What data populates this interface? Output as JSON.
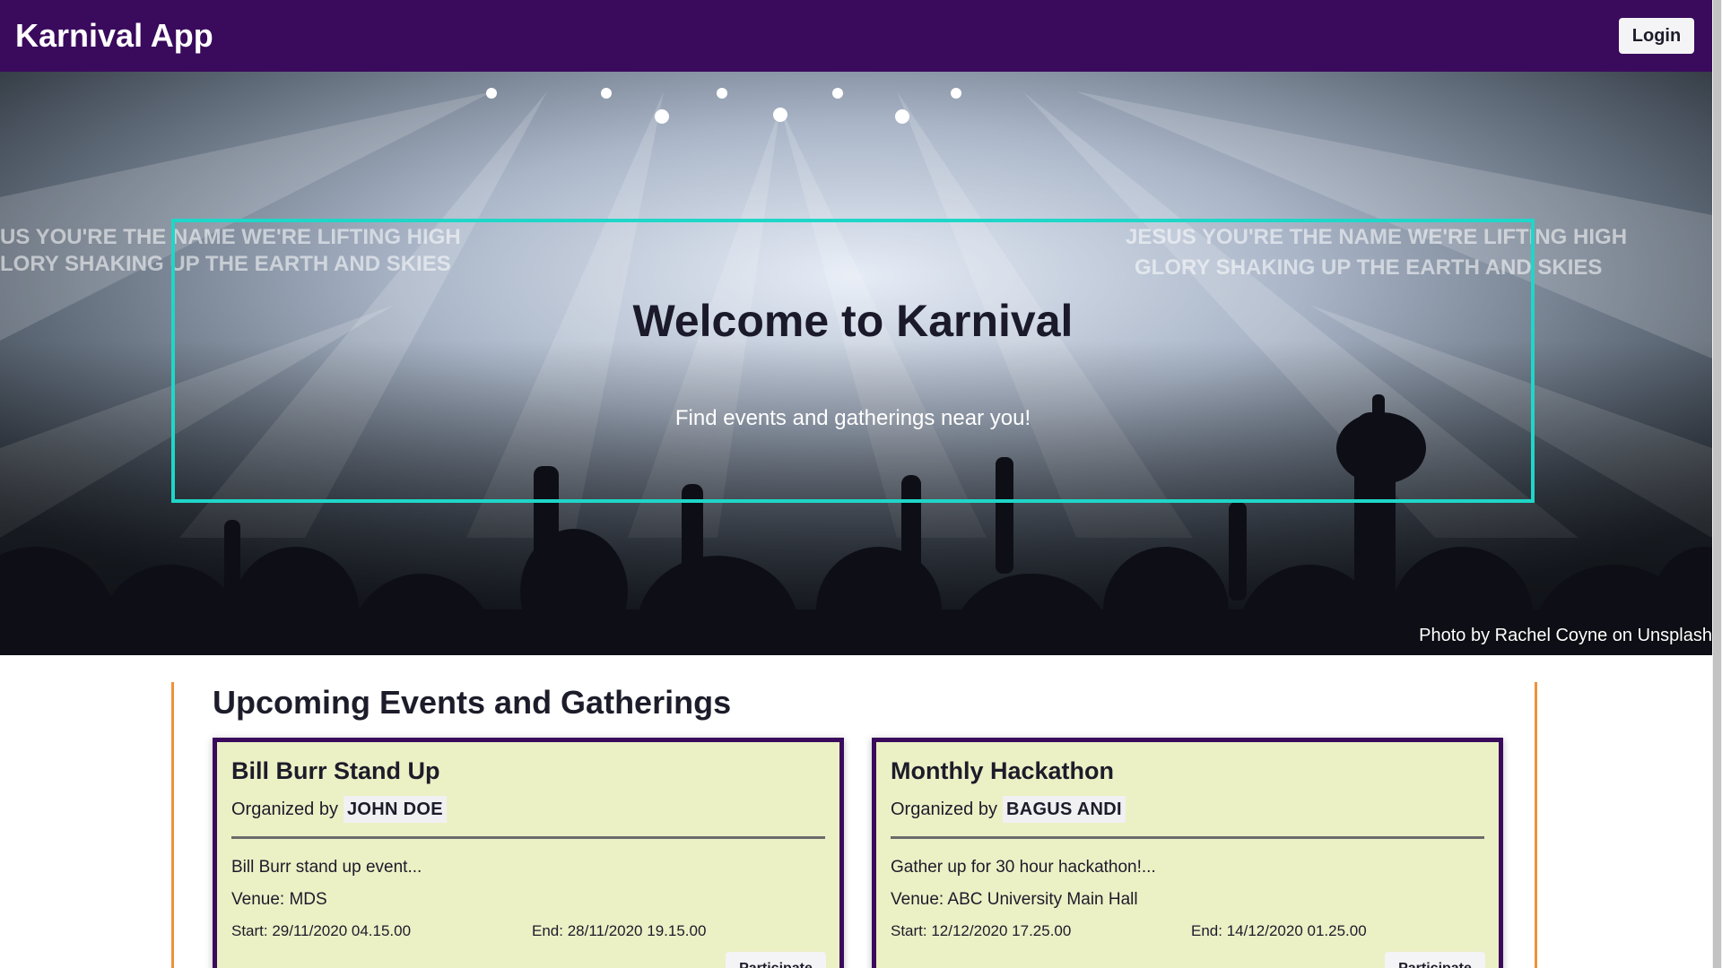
{
  "navbar": {
    "brand": "Karnival App",
    "login_label": "Login",
    "background_color": "#3a0a5c"
  },
  "hero": {
    "title": "Welcome to Karnival",
    "subtitle": "Find events and gatherings near you!",
    "photo_credit": "Photo by Rachel Coyne on Unsplash",
    "box_border_color": "#1fd6c8",
    "image_lyrics_left": [
      "US YOU'RE THE NAME WE'RE LIFTING HIGH",
      "LORY SHAKING UP THE EARTH AND SKIES"
    ],
    "image_lyrics_right": [
      "JESUS YOU'RE THE NAME WE'RE LIFTING HIGH",
      "GLORY SHAKING UP THE EARTH AND SKIES"
    ]
  },
  "events": {
    "heading": "Upcoming Events and Gatherings",
    "section_border_color": "#f0913a",
    "card_background": "#ecf0c5",
    "items": [
      {
        "title": "Bill Burr Stand Up",
        "organized_by_label": "Organized by",
        "organizer": "JOHN DOE",
        "description": "Bill Burr stand up event...",
        "venue": "Venue: MDS",
        "start": "Start: 29/11/2020 04.15.00",
        "end": "End: 28/11/2020 19.15.00",
        "participate_label": "Participate"
      },
      {
        "title": "Monthly Hackathon",
        "organized_by_label": "Organized by",
        "organizer": "BAGUS ANDI",
        "description": "Gather up for 30 hour hackathon!...",
        "venue": "Venue: ABC University Main Hall",
        "start": "Start: 12/12/2020 17.25.00",
        "end": "End: 14/12/2020 01.25.00",
        "participate_label": "Participate"
      }
    ]
  }
}
